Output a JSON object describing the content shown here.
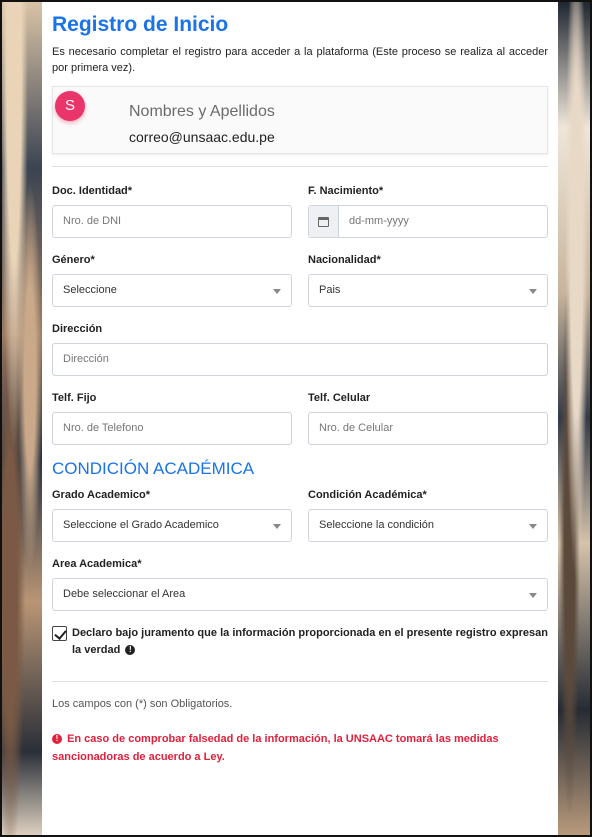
{
  "form": {
    "title": "Registro de Inicio",
    "intro": "Es necesario completar el registro para acceder a la plataforma (Este proceso se realiza al acceder por primera vez)."
  },
  "user": {
    "avatar_letter": "S",
    "avatar_color": "#e9356a",
    "name": "Nombres y Apellidos",
    "email": "correo@unsaac.edu.pe"
  },
  "fields": {
    "doc_identidad": {
      "label": "Doc. Identidad*",
      "placeholder": "Nro. de DNI"
    },
    "f_nacimiento": {
      "label": "F. Nacimiento*",
      "placeholder": "dd-mm-yyyy",
      "icon": "calendar-icon"
    },
    "genero": {
      "label": "Género*",
      "value": "Seleccione"
    },
    "nacionalidad": {
      "label": "Nacionalidad*",
      "value": "Pais"
    },
    "direccion": {
      "label": "Dirección",
      "placeholder": "Dirección"
    },
    "telf_fijo": {
      "label": "Telf. Fijo",
      "placeholder": "Nro. de Telefono"
    },
    "telf_celular": {
      "label": "Telf. Celular",
      "placeholder": "Nro. de Celular"
    }
  },
  "academic": {
    "section_title": "CONDICIÓN ACADÉMICA",
    "grado": {
      "label": "Grado Academico*",
      "value": "Seleccione el Grado Academico"
    },
    "condicion": {
      "label": "Condición Académica*",
      "value": "Seleccione la condición"
    },
    "area": {
      "label": "Area Academica*",
      "value": "Debe seleccionar el Area"
    }
  },
  "declaration": {
    "checked": true,
    "text": "Declaro bajo juramento que la información proporcionada en el presente registro expresan la verdad"
  },
  "footer": {
    "required_note": "Los campos con (*) son Obligatorios.",
    "warning": "En caso de comprobar falsedad de la información, la UNSAAC tomará las medidas sancionadoras de acuerdo a Ley.",
    "warning_color": "#e0203c"
  },
  "accent_color": "#1a73e8"
}
